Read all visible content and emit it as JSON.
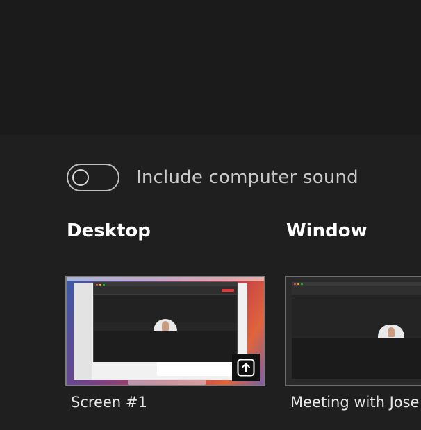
{
  "sound": {
    "label": "Include computer sound",
    "enabled": false
  },
  "sections": {
    "desktop_heading": "Desktop",
    "window_heading": "Window"
  },
  "thumbnails": {
    "desktop_caption": "Screen #1",
    "window_caption": "Meeting with Jose"
  },
  "icons": {
    "share": "share-upload-icon",
    "toggle": "toggle-off"
  },
  "colors": {
    "background": "#1f1f1f",
    "top_area": "#1b1b1b",
    "heading_text": "#ffffff",
    "label_text": "#c9c9c9"
  }
}
